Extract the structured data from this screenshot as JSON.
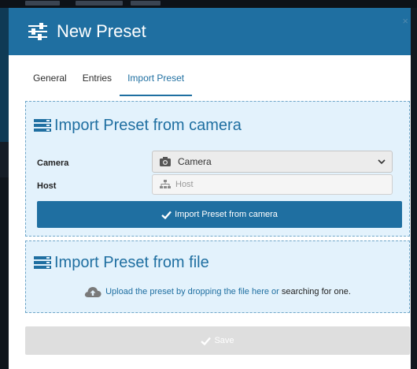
{
  "dialog": {
    "title": "New Preset",
    "close_label": "×"
  },
  "tabs": [
    {
      "label": "General",
      "active": false
    },
    {
      "label": "Entries",
      "active": false
    },
    {
      "label": "Import Preset",
      "active": true
    }
  ],
  "camera_section": {
    "title": "Import Preset from camera",
    "camera_label": "Camera",
    "camera_value": "Camera",
    "host_label": "Host",
    "host_placeholder": "Host",
    "import_button": "Import Preset from camera"
  },
  "file_section": {
    "title": "Import Preset from file",
    "upload_text": "Upload the preset by dropping the file here or",
    "upload_link": "searching for one",
    "upload_end": "."
  },
  "footer": {
    "save_label": "Save"
  },
  "icons": {
    "header": "sliders-icon",
    "section": "list-icon",
    "camera": "camera-icon",
    "host": "sitemap-icon",
    "check": "check-icon",
    "upload": "cloud-upload-icon",
    "caret": "chevron-down-icon"
  },
  "colors": {
    "primary": "#1f6fa1",
    "panel_bg": "#e3f2fc",
    "panel_border": "#6fa6c8",
    "disabled": "#dedede"
  }
}
